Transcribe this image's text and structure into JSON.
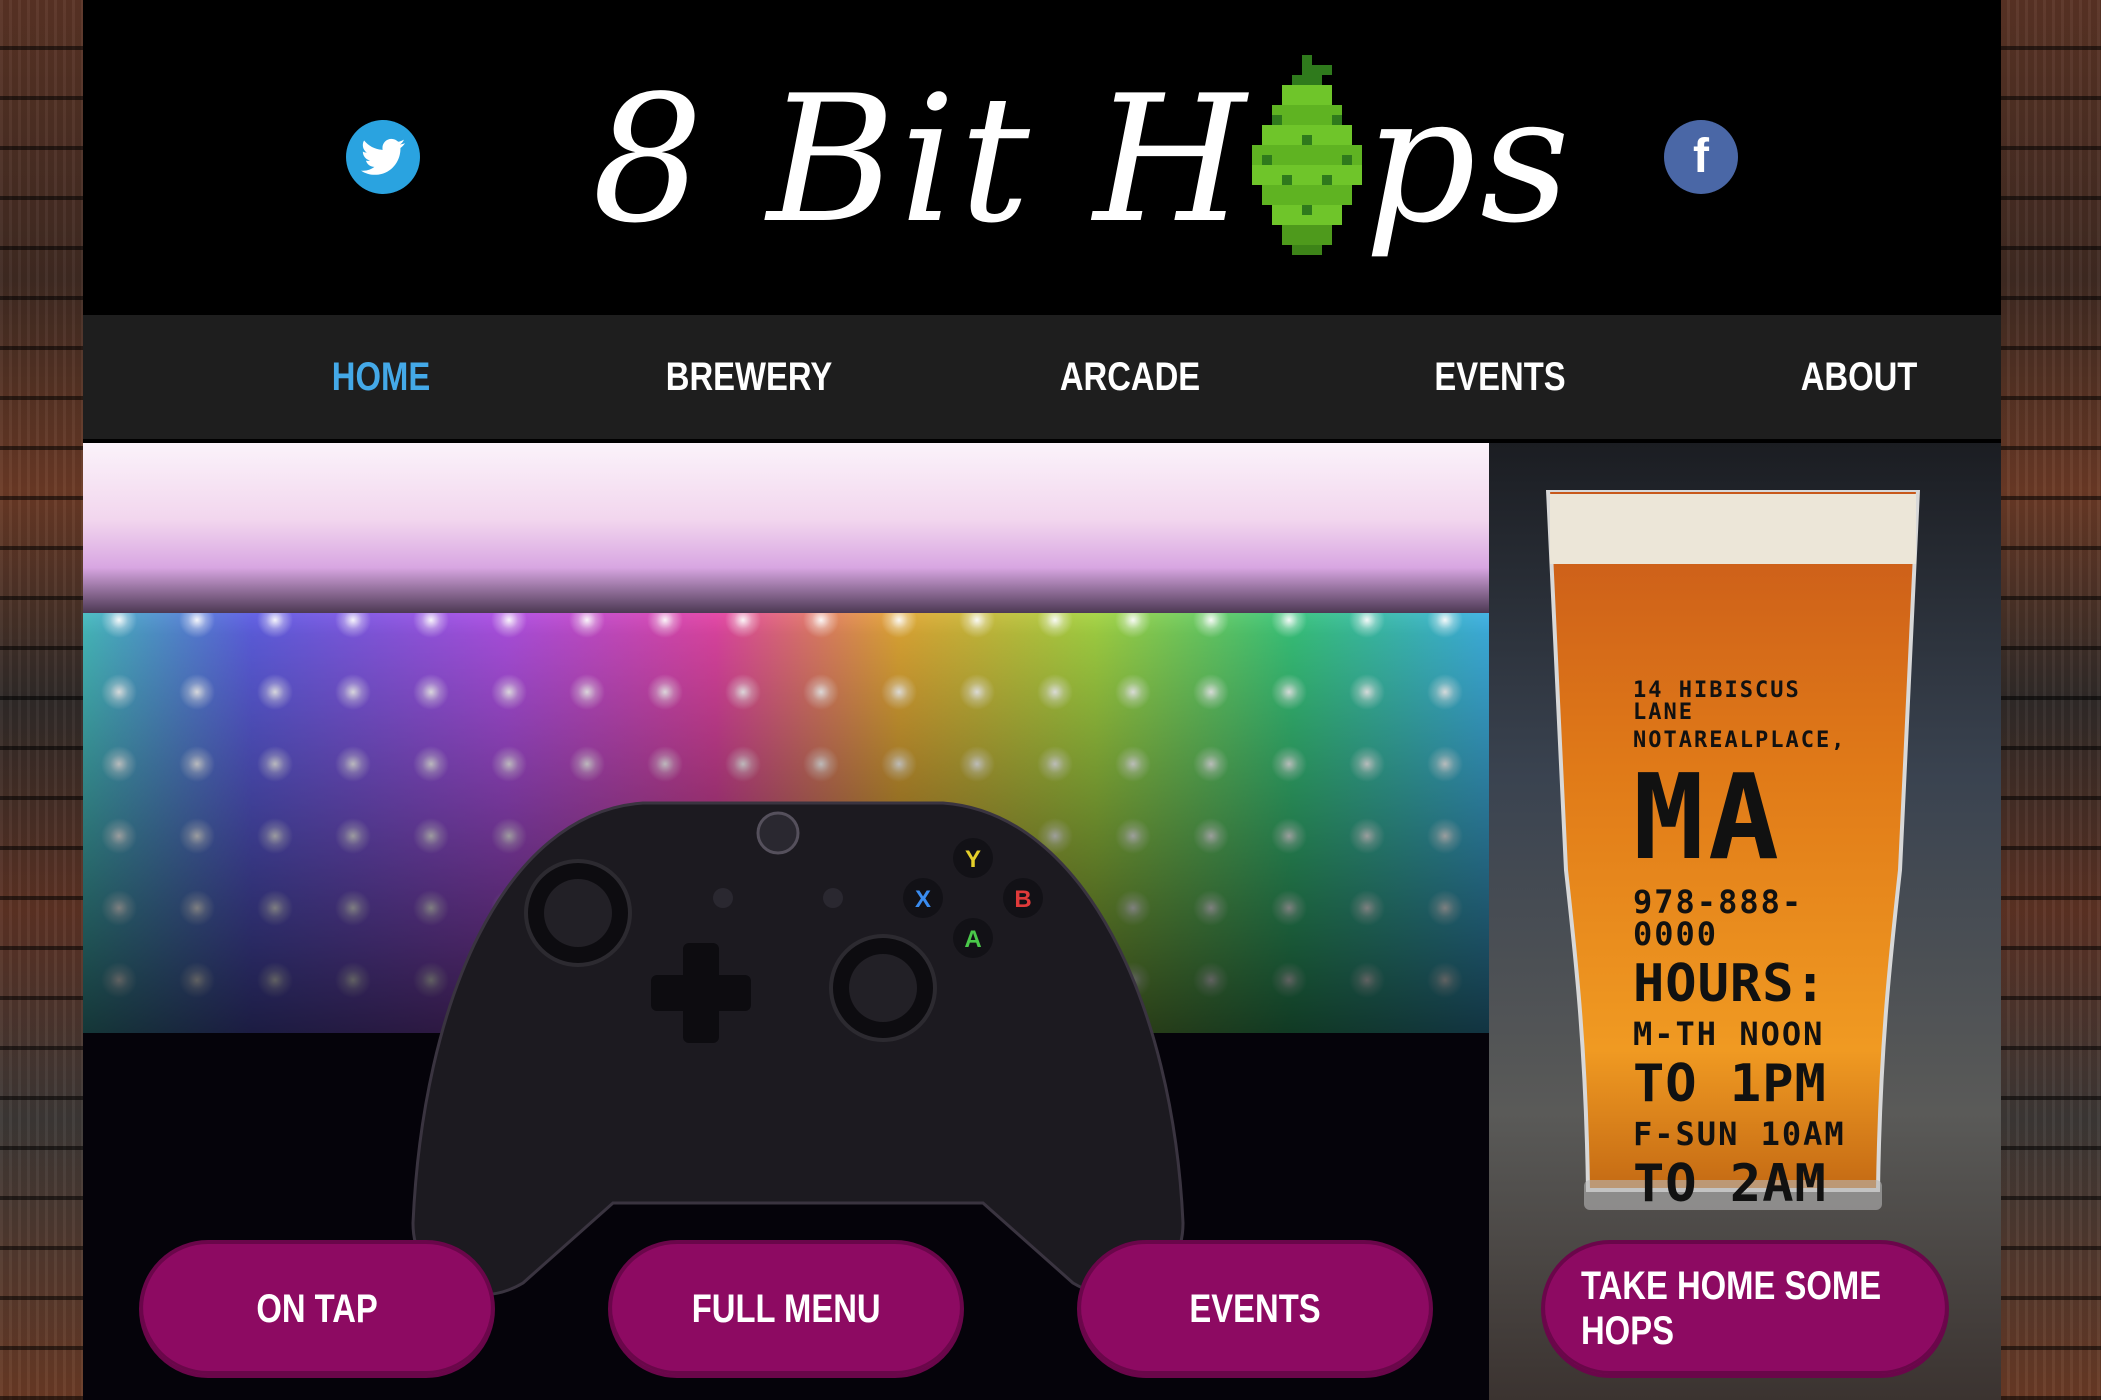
{
  "site": {
    "logo_text_before": "8 Bit H",
    "logo_text_after": "ps"
  },
  "social": {
    "twitter_icon": "twitter-icon",
    "facebook_icon": "facebook-icon",
    "facebook_glyph": "f"
  },
  "nav": {
    "items": [
      {
        "label": "HOME",
        "active": true
      },
      {
        "label": "BREWERY",
        "active": false
      },
      {
        "label": "ARCADE",
        "active": false
      },
      {
        "label": "EVENTS",
        "active": false
      },
      {
        "label": "ABOUT",
        "active": false
      }
    ]
  },
  "glass_info": {
    "address_line1": "14 HIBISCUS LANE",
    "address_line2": "NOTAREALPLACE,",
    "state": "MA",
    "phone": "978-888-0000",
    "hours_label": "HOURS:",
    "hours_line1": "M-TH NOON",
    "hours_line2": "TO 1PM",
    "hours_line3": "F-SUN 10AM",
    "hours_line4": "TO 2AM"
  },
  "buttons": {
    "on_tap": "ON TAP",
    "full_menu": "FULL MENU",
    "events": "EVENTS",
    "take_home": "TAKE HOME SOME HOPS"
  },
  "colors": {
    "accent_blue": "#44a9e8",
    "button_magenta": "#8d0a62",
    "twitter_blue": "#2aa3e0",
    "facebook_blue": "#4a67a6",
    "hop_green": "#6fc52a"
  }
}
